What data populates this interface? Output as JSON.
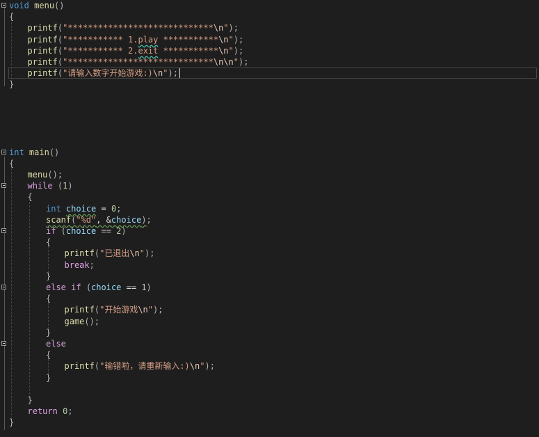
{
  "editor": {
    "lines": [
      {
        "row": 0,
        "indent": 0,
        "fold": true,
        "tokens": [
          [
            "void",
            "kw"
          ],
          [
            " ",
            ""
          ],
          [
            "menu",
            "fn"
          ],
          [
            "()",
            "punc"
          ]
        ]
      },
      {
        "row": 1,
        "indent": 0,
        "fold": false,
        "tokens": [
          [
            "{",
            "punc"
          ]
        ]
      },
      {
        "row": 2,
        "indent": 1,
        "fold": false,
        "tokens": [
          [
            "printf",
            "fn"
          ],
          [
            "(",
            "punc"
          ],
          [
            "\"*****************************",
            "str"
          ],
          [
            "\\n",
            "esc"
          ],
          [
            "\"",
            "str"
          ],
          [
            ");",
            "punc"
          ]
        ]
      },
      {
        "row": 3,
        "indent": 1,
        "fold": false,
        "tokens": [
          [
            "printf",
            "fn"
          ],
          [
            "(",
            "punc"
          ],
          [
            "\"*********** 1.",
            "str"
          ],
          [
            "play",
            "str squig-r"
          ],
          [
            " ***********",
            "str"
          ],
          [
            "\\n",
            "esc"
          ],
          [
            "\"",
            "str"
          ],
          [
            ");",
            "punc"
          ]
        ]
      },
      {
        "row": 4,
        "indent": 1,
        "fold": false,
        "tokens": [
          [
            "printf",
            "fn"
          ],
          [
            "(",
            "punc"
          ],
          [
            "\"*********** 2.",
            "str"
          ],
          [
            "exit",
            "str squig-r"
          ],
          [
            " ***********",
            "str"
          ],
          [
            "\\n",
            "esc"
          ],
          [
            "\"",
            "str"
          ],
          [
            ");",
            "punc"
          ]
        ]
      },
      {
        "row": 5,
        "indent": 1,
        "fold": false,
        "tokens": [
          [
            "printf",
            "fn"
          ],
          [
            "(",
            "punc"
          ],
          [
            "\"*****************************",
            "str"
          ],
          [
            "\\n\\n",
            "esc"
          ],
          [
            "\"",
            "str"
          ],
          [
            ");",
            "punc"
          ]
        ]
      },
      {
        "row": 6,
        "indent": 1,
        "fold": false,
        "tokens": [
          [
            "printf",
            "fn"
          ],
          [
            "(",
            "punc"
          ],
          [
            "\"请输入数字开始游戏:)",
            "str"
          ],
          [
            "\\n",
            "esc"
          ],
          [
            "\"",
            "str"
          ],
          [
            ");",
            "punc"
          ]
        ]
      },
      {
        "row": 7,
        "indent": 0,
        "fold": false,
        "tokens": [
          [
            "}",
            "punc"
          ]
        ]
      },
      {
        "row": 13,
        "indent": 0,
        "fold": true,
        "tokens": [
          [
            "int",
            "kw"
          ],
          [
            " ",
            ""
          ],
          [
            "main",
            "fn"
          ],
          [
            "()",
            "punc"
          ]
        ]
      },
      {
        "row": 14,
        "indent": 0,
        "fold": false,
        "tokens": [
          [
            "{",
            "punc"
          ]
        ]
      },
      {
        "row": 15,
        "indent": 1,
        "fold": false,
        "tokens": [
          [
            "menu",
            "fn"
          ],
          [
            "();",
            "punc"
          ]
        ]
      },
      {
        "row": 16,
        "indent": 1,
        "fold": true,
        "tokens": [
          [
            "while",
            "kw2"
          ],
          [
            " ",
            ""
          ],
          [
            "(",
            "punc"
          ],
          [
            "1",
            "num"
          ],
          [
            ")",
            "punc"
          ]
        ]
      },
      {
        "row": 17,
        "indent": 1,
        "fold": false,
        "tokens": [
          [
            "{",
            "punc"
          ]
        ]
      },
      {
        "row": 18,
        "indent": 2,
        "fold": false,
        "tokens": [
          [
            "int",
            "kw"
          ],
          [
            " ",
            ""
          ],
          [
            "choice",
            "var squig"
          ],
          [
            " = ",
            "plain"
          ],
          [
            "0",
            "num"
          ],
          [
            ";",
            "punc"
          ]
        ]
      },
      {
        "row": 19,
        "indent": 2,
        "fold": false,
        "tokens": [
          [
            "scanf",
            "fn squig"
          ],
          [
            "(",
            "punc squig"
          ],
          [
            "\"%d\"",
            "str squig"
          ],
          [
            ", &",
            "plain squig"
          ],
          [
            "choice",
            "var squig"
          ],
          [
            ")",
            "punc squig"
          ],
          [
            ";",
            "punc"
          ]
        ]
      },
      {
        "row": 20,
        "indent": 2,
        "fold": true,
        "tokens": [
          [
            "if",
            "kw2"
          ],
          [
            " (",
            "punc"
          ],
          [
            "choice",
            "var"
          ],
          [
            " == ",
            "plain"
          ],
          [
            "2",
            "num"
          ],
          [
            ")",
            "punc"
          ]
        ]
      },
      {
        "row": 21,
        "indent": 2,
        "fold": false,
        "tokens": [
          [
            "{",
            "punc"
          ]
        ]
      },
      {
        "row": 22,
        "indent": 3,
        "fold": false,
        "tokens": [
          [
            "printf",
            "fn"
          ],
          [
            "(",
            "punc"
          ],
          [
            "\"已退出",
            "str"
          ],
          [
            "\\n",
            "esc"
          ],
          [
            "\"",
            "str"
          ],
          [
            ");",
            "punc"
          ]
        ]
      },
      {
        "row": 23,
        "indent": 3,
        "fold": false,
        "tokens": [
          [
            "break",
            "kw2"
          ],
          [
            ";",
            "punc"
          ]
        ]
      },
      {
        "row": 24,
        "indent": 2,
        "fold": false,
        "tokens": [
          [
            "}",
            "punc"
          ]
        ]
      },
      {
        "row": 25,
        "indent": 2,
        "fold": true,
        "tokens": [
          [
            "else",
            "kw2"
          ],
          [
            " ",
            ""
          ],
          [
            "if",
            "kw2"
          ],
          [
            " (",
            "punc"
          ],
          [
            "choice",
            "var"
          ],
          [
            " == ",
            "plain"
          ],
          [
            "1",
            "num"
          ],
          [
            ")",
            "punc"
          ]
        ]
      },
      {
        "row": 26,
        "indent": 2,
        "fold": false,
        "tokens": [
          [
            "{",
            "punc"
          ]
        ]
      },
      {
        "row": 27,
        "indent": 3,
        "fold": false,
        "tokens": [
          [
            "printf",
            "fn"
          ],
          [
            "(",
            "punc"
          ],
          [
            "\"开始游戏",
            "str"
          ],
          [
            "\\n",
            "esc"
          ],
          [
            "\"",
            "str"
          ],
          [
            ");",
            "punc"
          ]
        ]
      },
      {
        "row": 28,
        "indent": 3,
        "fold": false,
        "tokens": [
          [
            "game",
            "fn"
          ],
          [
            "();",
            "punc"
          ]
        ]
      },
      {
        "row": 29,
        "indent": 2,
        "fold": false,
        "tokens": [
          [
            "}",
            "punc"
          ]
        ]
      },
      {
        "row": 30,
        "indent": 2,
        "fold": true,
        "tokens": [
          [
            "else",
            "kw2"
          ]
        ]
      },
      {
        "row": 31,
        "indent": 2,
        "fold": false,
        "tokens": [
          [
            "{",
            "punc"
          ]
        ]
      },
      {
        "row": 32,
        "indent": 3,
        "fold": false,
        "tokens": [
          [
            "printf",
            "fn"
          ],
          [
            "(",
            "punc"
          ],
          [
            "\"输错啦，请重新输入:)",
            "str"
          ],
          [
            "\\n",
            "esc"
          ],
          [
            "\"",
            "str"
          ],
          [
            ");",
            "punc"
          ]
        ]
      },
      {
        "row": 33,
        "indent": 2,
        "fold": false,
        "tokens": [
          [
            "}",
            "punc"
          ]
        ]
      },
      {
        "row": 35,
        "indent": 1,
        "fold": false,
        "tokens": [
          [
            "}",
            "punc"
          ]
        ]
      },
      {
        "row": 36,
        "indent": 1,
        "fold": false,
        "tokens": [
          [
            "return",
            "kw2"
          ],
          [
            " ",
            ""
          ],
          [
            "0",
            "num"
          ],
          [
            ";",
            "punc"
          ]
        ]
      },
      {
        "row": 37,
        "indent": 0,
        "fold": false,
        "tokens": [
          [
            "}",
            "punc"
          ]
        ]
      }
    ]
  }
}
